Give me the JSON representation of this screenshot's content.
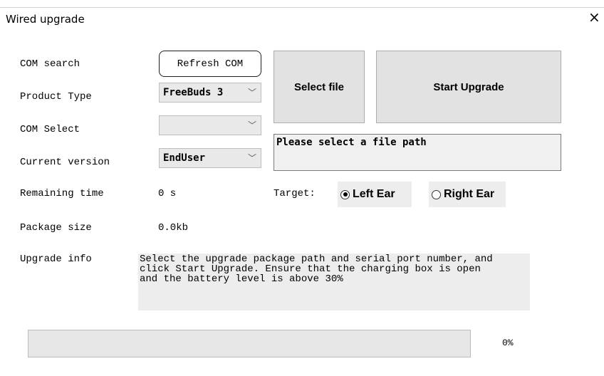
{
  "window": {
    "title": "Wired upgrade",
    "close_glyph": "×",
    "close_icon": "close-icon"
  },
  "labels": {
    "com_search": "COM search",
    "product_type": "Product Type",
    "com_select": "COM Select",
    "current_version": "Current version",
    "remaining_time": "Remaining time",
    "package_size": "Package size",
    "upgrade_info": "Upgrade info"
  },
  "buttons": {
    "refresh_com": "Refresh COM",
    "select_file": "Select file",
    "start_upgrade": "Start Upgrade"
  },
  "combos": {
    "product_type": "FreeBuds 3",
    "com_select": "",
    "current_version": "EndUser",
    "chevron_glyph": "﹀"
  },
  "values": {
    "remaining_time": "0 s",
    "package_size": "0.0kb"
  },
  "file_path": "Please select a file path",
  "target": {
    "label": "Target:",
    "left_ear": "Left Ear",
    "right_ear": "Right Ear",
    "selected": "left_ear"
  },
  "upgrade_info_text": "Select the upgrade package path and serial port number, and\nclick Start Upgrade. Ensure that the charging box is open\nand the battery level is above 30%",
  "progress": {
    "value": 0,
    "label": "0%"
  },
  "colors": {
    "progress_fill": "#06b025",
    "button_bg": "#e2e2e2"
  }
}
